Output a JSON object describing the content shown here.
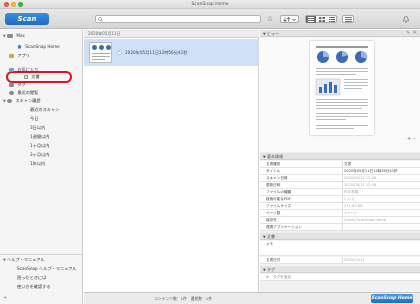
{
  "window": {
    "title": "ScanSnap Home"
  },
  "toolbar": {
    "scan_label": "Scan",
    "search_placeholder": "",
    "icons": [
      "search-icon",
      "star-icon",
      "sort-icon",
      "list-view-icon",
      "thumbnail-view-icon",
      "detail-view-icon",
      "filter-icon",
      "notification-icon"
    ]
  },
  "sidebar": {
    "root_label": "Mac",
    "home_label": "ScanSnap Home",
    "other_label": "アプリ",
    "items": [
      {
        "label": "お気に入り"
      },
      {
        "label": "文書"
      },
      {
        "label": "タグ"
      },
      {
        "label": "最近の閲覧"
      },
      {
        "label": "スキャン履歴"
      },
      {
        "label": "最近のスキャン"
      },
      {
        "label": "今日"
      },
      {
        "label": "3日以内"
      },
      {
        "label": "1週間以内"
      },
      {
        "label": "1ヶ月以内"
      },
      {
        "label": "3ヶ月以内"
      },
      {
        "label": "1年以内"
      }
    ],
    "help": {
      "header": "ヘルプ・マニュアル",
      "items": [
        {
          "label": "ScanSnap ヘルプ・マニュアル"
        },
        {
          "label": "困ったときには"
        },
        {
          "label": "使い方を確認する"
        }
      ]
    }
  },
  "list": {
    "header": "2020年05月11日",
    "document_title": "2020年05月11日12時56分41秒"
  },
  "status_bar": {
    "text": "コンテンツ数：1件　選択数：1件",
    "brand": "ScanSnap Home"
  },
  "right_panel": {
    "viewer_header": "ビュー",
    "info_header": "基本情報",
    "properties": [
      {
        "label": "文書種別",
        "value": "文書"
      },
      {
        "label": "タイトル",
        "value": "2020年05月11日12時56分41秒"
      },
      {
        "label": "スキャン日時",
        "value": "2020/05/11 12:56"
      },
      {
        "label": "更新日時",
        "value": "2020/05/11 12:56"
      },
      {
        "label": "ファイルの種類",
        "value": "PDF書類"
      },
      {
        "label": "検索可能なPDF",
        "value": "いいえ"
      },
      {
        "label": "ファイルサイズ",
        "value": "271.00 KB"
      },
      {
        "label": "ページ数",
        "value": "1ページ"
      },
      {
        "label": "保存先",
        "value": "/Users/ScanSnap Home"
      },
      {
        "label": "連携アプリケーション",
        "value": ""
      }
    ],
    "doc_header": "文書",
    "memo_label": "メモ",
    "date_label": "文書日付",
    "date_value": "2020/05/11",
    "tag_header": "タグ",
    "tag_add": "タグを追加"
  }
}
